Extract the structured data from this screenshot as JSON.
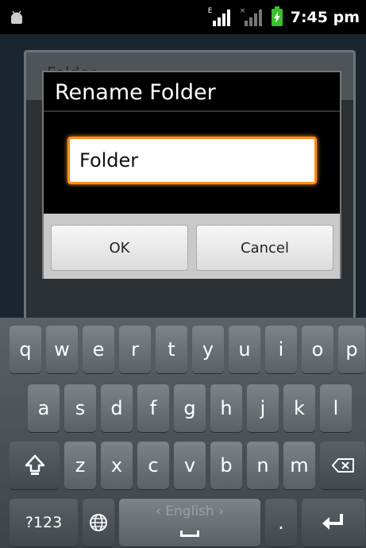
{
  "status_bar": {
    "time": "7:45 pm",
    "signal1_label": "E",
    "signal2_label": "×",
    "icons": [
      "android-debug-icon",
      "signal-icon",
      "signal-icon",
      "battery-charging-icon"
    ]
  },
  "background": {
    "title": "Folder"
  },
  "dialog": {
    "title": "Rename Folder",
    "input_value": "Folder",
    "ok_label": "OK",
    "cancel_label": "Cancel"
  },
  "keyboard": {
    "row1": [
      "q",
      "w",
      "e",
      "r",
      "t",
      "y",
      "u",
      "i",
      "o",
      "p"
    ],
    "row2": [
      "a",
      "s",
      "d",
      "f",
      "g",
      "h",
      "j",
      "k",
      "l"
    ],
    "row3": [
      "z",
      "x",
      "c",
      "v",
      "b",
      "n",
      "m"
    ],
    "symbols_label": "?123",
    "space_label": "‹ English ›",
    "period_label": ".",
    "accent_color": "#ff8c1a"
  }
}
